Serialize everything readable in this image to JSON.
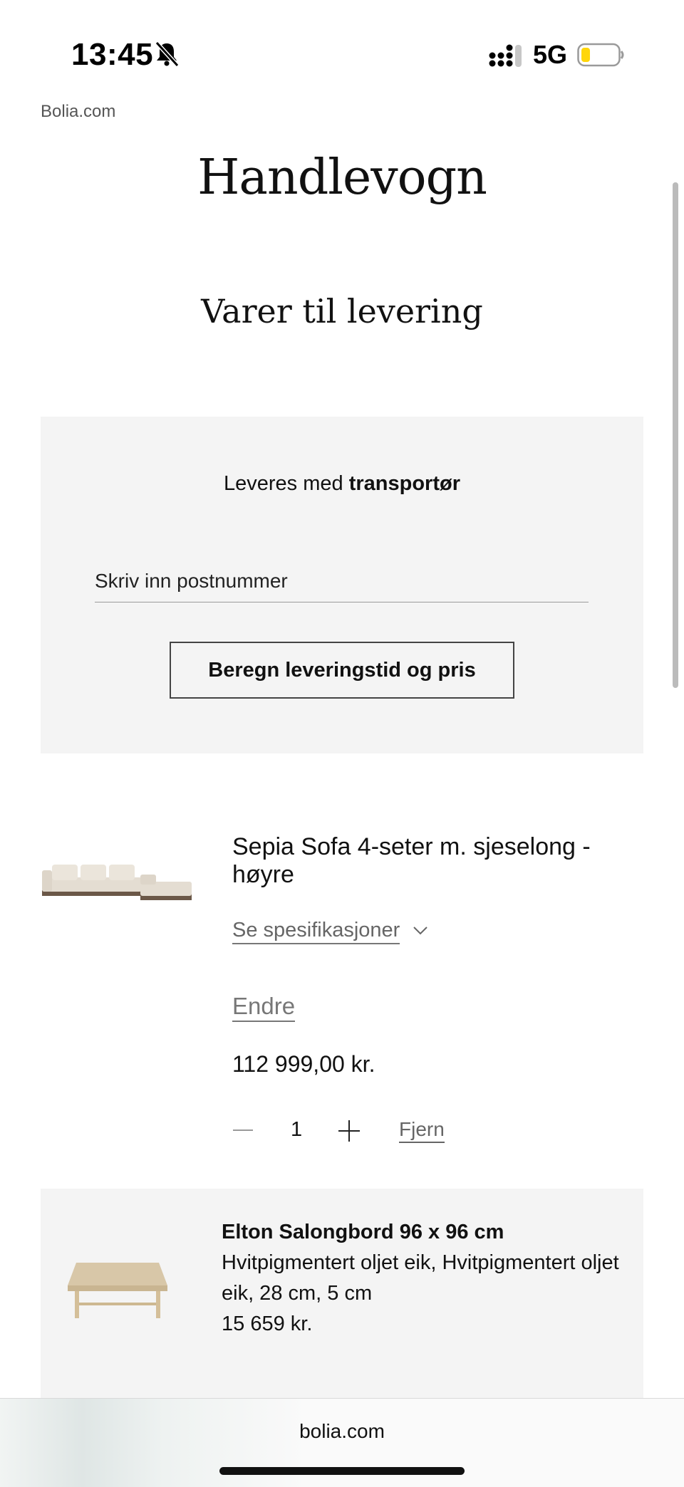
{
  "status_bar": {
    "time": "13:45",
    "network": "5G",
    "battery_color": "#ffd60a"
  },
  "site": {
    "label": "Bolia.com"
  },
  "page": {
    "title": "Handlevogn",
    "section": "Varer til levering"
  },
  "delivery": {
    "prefix": "Leveres med ",
    "method": "transportør",
    "postal_placeholder": "Skriv inn postnummer",
    "postal_value": "",
    "calculate_button": "Beregn leveringstid og pris"
  },
  "cart_item": {
    "name": "Sepia Sofa 4-seter m. sjeselong - høyre",
    "specs_link": "Se spesifikasjoner",
    "edit_link": "Endre",
    "price": "112 999,00 kr.",
    "quantity": "1",
    "remove_link": "Fjern"
  },
  "recommended_item": {
    "name": "Elton Salongbord 96 x 96 cm",
    "details": "Hvitpigmentert oljet eik, Hvitpigmentert oljet eik, 28 cm, 5 cm",
    "price": "15 659 kr."
  },
  "browser": {
    "url": "bolia.com"
  }
}
